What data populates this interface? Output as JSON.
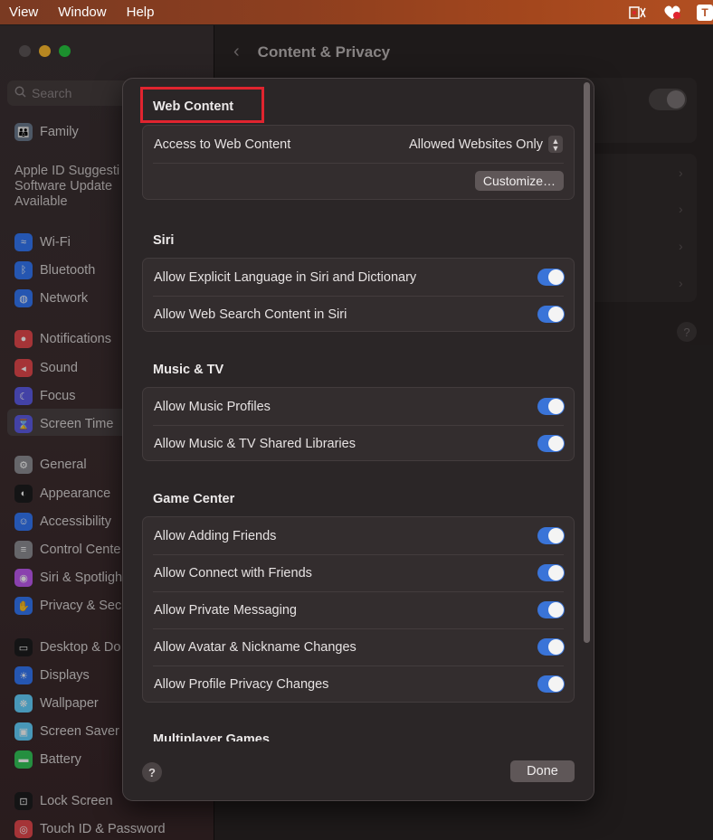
{
  "menubar": {
    "items": [
      "View",
      "Window",
      "Help"
    ],
    "tray_icons": [
      "media-icon",
      "heart-icon",
      "text-icon"
    ],
    "tray_text_label": "T"
  },
  "sidebar": {
    "search_placeholder": "Search",
    "notice_lines": [
      "Apple ID Suggesti",
      "Software Update",
      "Available"
    ],
    "items": [
      {
        "label": "Family",
        "icon": "family-icon",
        "color": "#6b7a8e"
      },
      {
        "label": "Wi-Fi",
        "icon": "wifi-icon",
        "color": "#3478f6"
      },
      {
        "label": "Bluetooth",
        "icon": "bluetooth-icon",
        "color": "#3478f6"
      },
      {
        "label": "Network",
        "icon": "network-icon",
        "color": "#3478f6"
      },
      {
        "label": "Notifications",
        "icon": "bell-icon",
        "color": "#e5484d"
      },
      {
        "label": "Sound",
        "icon": "speaker-icon",
        "color": "#e5484d"
      },
      {
        "label": "Focus",
        "icon": "moon-icon",
        "color": "#5e5ce6"
      },
      {
        "label": "Screen Time",
        "icon": "hourglass-icon",
        "color": "#5e5ce6"
      },
      {
        "label": "General",
        "icon": "gear-icon",
        "color": "#8e8e93"
      },
      {
        "label": "Appearance",
        "icon": "appearance-icon",
        "color": "#1c1c1e"
      },
      {
        "label": "Accessibility",
        "icon": "accessibility-icon",
        "color": "#3478f6"
      },
      {
        "label": "Control Cente",
        "icon": "control-center-icon",
        "color": "#8e8e93"
      },
      {
        "label": "Siri & Spotligh",
        "icon": "siri-icon",
        "color": "#bf5af2"
      },
      {
        "label": "Privacy & Sec",
        "icon": "hand-icon",
        "color": "#3478f6"
      },
      {
        "label": "Desktop & Do",
        "icon": "desktop-icon",
        "color": "#1c1c1e"
      },
      {
        "label": "Displays",
        "icon": "display-icon",
        "color": "#3478f6"
      },
      {
        "label": "Wallpaper",
        "icon": "wallpaper-icon",
        "color": "#64d2ff"
      },
      {
        "label": "Screen Saver",
        "icon": "screensaver-icon",
        "color": "#64d2ff"
      },
      {
        "label": "Battery",
        "icon": "battery-icon",
        "color": "#34c759"
      },
      {
        "label": "Lock Screen",
        "icon": "lock-icon",
        "color": "#1c1c1e"
      },
      {
        "label": "Touch ID & Password",
        "icon": "fingerprint-icon",
        "color": "#e5484d"
      }
    ]
  },
  "content": {
    "back_glyph": "‹",
    "title": "Content & Privacy"
  },
  "sheet": {
    "sections": [
      {
        "title": "Web Content",
        "rows": [
          {
            "label": "Access to Web Content",
            "type": "popup",
            "value": "Allowed Websites Only"
          }
        ],
        "button": "Customize…"
      },
      {
        "title": "Siri",
        "rows": [
          {
            "label": "Allow Explicit Language in Siri and Dictionary",
            "type": "toggle",
            "on": true
          },
          {
            "label": "Allow Web Search Content in Siri",
            "type": "toggle",
            "on": true
          }
        ]
      },
      {
        "title": "Music & TV",
        "rows": [
          {
            "label": "Allow Music Profiles",
            "type": "toggle",
            "on": true
          },
          {
            "label": "Allow Music & TV Shared Libraries",
            "type": "toggle",
            "on": true
          }
        ]
      },
      {
        "title": "Game Center",
        "rows": [
          {
            "label": "Allow Adding Friends",
            "type": "toggle",
            "on": true
          },
          {
            "label": "Allow Connect with Friends",
            "type": "toggle",
            "on": true
          },
          {
            "label": "Allow Private Messaging",
            "type": "toggle",
            "on": true
          },
          {
            "label": "Allow Avatar & Nickname Changes",
            "type": "toggle",
            "on": true
          },
          {
            "label": "Allow Profile Privacy Changes",
            "type": "toggle",
            "on": true
          }
        ]
      },
      {
        "title": "Multiplayer Games",
        "rows": []
      }
    ],
    "help_glyph": "?",
    "done_label": "Done"
  },
  "colors": {
    "accent": "#3a74d8",
    "highlight": "#e0242f"
  }
}
